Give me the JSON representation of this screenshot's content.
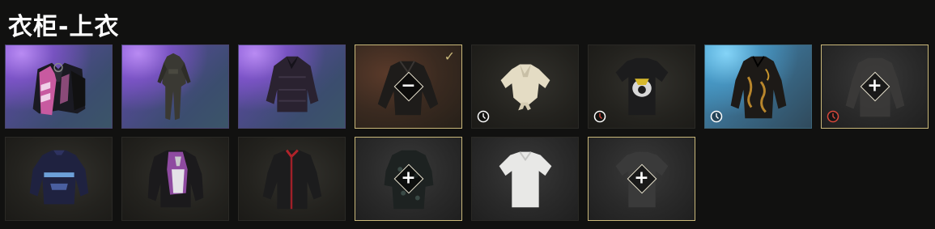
{
  "title": "衣柜-上衣",
  "icons": {
    "equipped": "checkmark-icon",
    "timed": "clock-icon",
    "remove": "minus-diamond-icon",
    "add": "plus-diamond-icon"
  },
  "symbols": {
    "minus": "−",
    "plus": "+",
    "check": "✓"
  },
  "colors": {
    "accent": "#c9b87a",
    "rare_purple": "#6d4fbd",
    "rare_blue": "#3f97c4",
    "timer_white": "#ffffff",
    "timer_red": "#d9483b"
  },
  "items": [
    {
      "name": "vest-jacket-pink-pattern",
      "equipped": false,
      "timer": null
    },
    {
      "name": "jumpsuit-camo",
      "equipped": false,
      "timer": null
    },
    {
      "name": "jacket-dark-pattern",
      "equipped": false,
      "timer": null
    },
    {
      "name": "jacket-black-equipped",
      "equipped": true,
      "timer": null
    },
    {
      "name": "tied-blouse-white",
      "equipped": false,
      "timer": "white"
    },
    {
      "name": "tshirt-black-print",
      "equipped": false,
      "timer": "red"
    },
    {
      "name": "jacket-black-gold",
      "equipped": false,
      "timer": "white"
    },
    {
      "name": "shirt-gray",
      "equipped": false,
      "timer": "red"
    },
    {
      "name": "sweater-navy",
      "equipped": false,
      "timer": null
    },
    {
      "name": "jacket-purple-white",
      "equipped": false,
      "timer": null
    },
    {
      "name": "shirt-black-red-collar",
      "equipped": false,
      "timer": null
    },
    {
      "name": "shirt-dark-floral",
      "equipped": false,
      "timer": null
    },
    {
      "name": "tshirt-white",
      "equipped": false,
      "timer": null
    },
    {
      "name": "tshirt-dark-gray",
      "equipped": false,
      "timer": null
    }
  ]
}
